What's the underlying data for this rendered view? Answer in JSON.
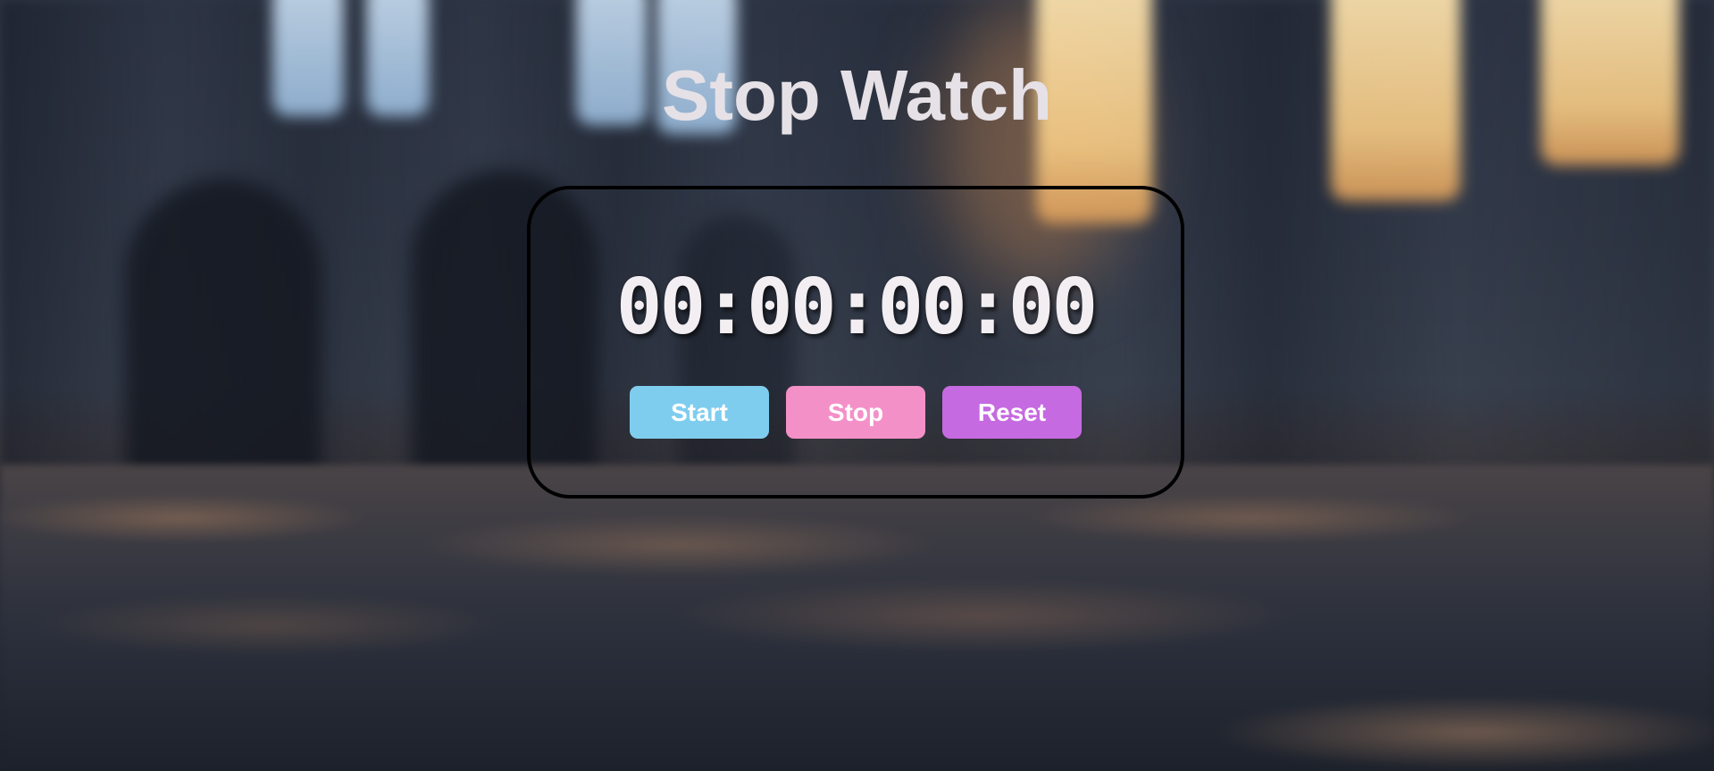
{
  "page": {
    "title": "Stop Watch"
  },
  "stopwatch": {
    "display": "00:00:00:00",
    "buttons": {
      "start_label": "Start",
      "stop_label": "Stop",
      "reset_label": "Reset"
    }
  },
  "colors": {
    "title_text": "#e6e1e6",
    "card_border": "#000000",
    "start_button": "#7fcdee",
    "stop_button": "#f490c8",
    "reset_button": "#c66ae1",
    "button_text": "#ffffff"
  }
}
